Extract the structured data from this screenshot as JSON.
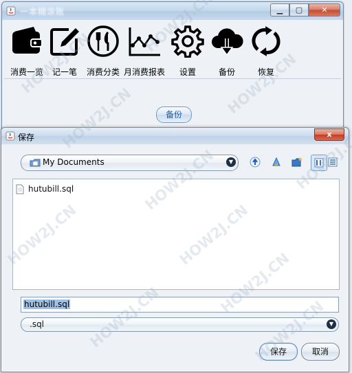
{
  "main_window": {
    "title": "一本糊涂账",
    "toolbar": [
      {
        "label": "消费一览",
        "icon": "wallet-icon"
      },
      {
        "label": "记一笔",
        "icon": "edit-pencil-icon"
      },
      {
        "label": "消费分类",
        "icon": "fork-knife-icon"
      },
      {
        "label": "月消费报表",
        "icon": "line-chart-icon"
      },
      {
        "label": "设置",
        "icon": "gear-icon"
      },
      {
        "label": "备份",
        "icon": "cloud-download-icon"
      },
      {
        "label": "恢复",
        "icon": "refresh-icon"
      }
    ],
    "backup_button": "备份"
  },
  "dialog": {
    "title": "保存",
    "close": "x",
    "look_in": "My Documents",
    "files": [
      {
        "name": "hutubill.sql",
        "icon": "document-icon"
      }
    ],
    "file_name_value": "hutubill.sql",
    "file_type": ".sql",
    "save_label": "保存",
    "cancel_label": "取消"
  },
  "watermark": "HOW2J.CN"
}
